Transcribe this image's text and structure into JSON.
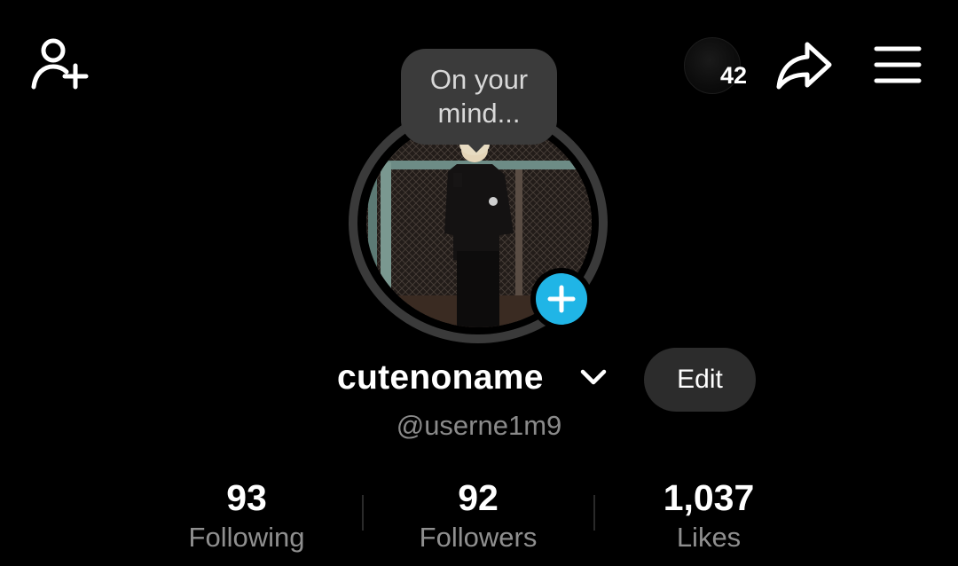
{
  "header": {
    "add_friend_icon": "person-plus-icon",
    "notification_count": "42",
    "share_icon": "share-arrow-icon",
    "menu_icon": "hamburger-menu-icon"
  },
  "note": {
    "text": "On your mind..."
  },
  "profile": {
    "display_name": "cutenoname",
    "handle": "@userne1m9",
    "edit_label": "Edit",
    "add_story_icon": "plus-icon",
    "accent_color": "#20b5e6"
  },
  "stats": [
    {
      "value": "93",
      "label": "Following"
    },
    {
      "value": "92",
      "label": "Followers"
    },
    {
      "value": "1,037",
      "label": "Likes"
    }
  ]
}
